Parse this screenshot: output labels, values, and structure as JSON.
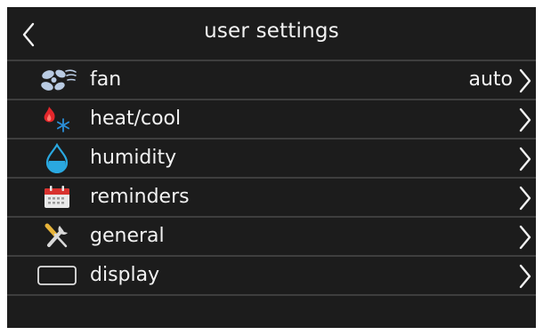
{
  "header": {
    "title": "user settings"
  },
  "items": [
    {
      "label": "fan",
      "value": "auto",
      "icon": "fan-icon"
    },
    {
      "label": "heat/cool",
      "value": "",
      "icon": "heat-cool-icon"
    },
    {
      "label": "humidity",
      "value": "",
      "icon": "water-drop-icon"
    },
    {
      "label": "reminders",
      "value": "",
      "icon": "calendar-icon"
    },
    {
      "label": "general",
      "value": "",
      "icon": "tools-icon"
    },
    {
      "label": "display",
      "value": "",
      "icon": "display-icon"
    }
  ],
  "colors": {
    "background": "#1c1c1c",
    "divider": "#3e3e3e",
    "text": "#f2f2f2",
    "fan_blue": "#b9cbe3",
    "flame_red": "#e3262b",
    "snow_blue": "#2b8fd8",
    "drop_blue": "#2aa8e0",
    "calendar_red": "#d8322e"
  }
}
